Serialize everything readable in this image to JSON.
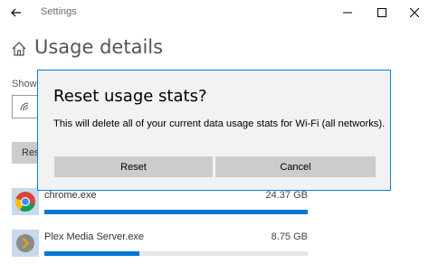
{
  "window": {
    "app_title": "Settings",
    "back_icon": "back-arrow-icon",
    "minimize_icon": "minimize-icon",
    "maximize_icon": "maximize-icon",
    "close_icon": "close-icon"
  },
  "page": {
    "title": "Usage details",
    "home_icon": "home-icon"
  },
  "background": {
    "show_label": "Show",
    "network_icon": "wifi-icon",
    "reset_button_label": "Rese"
  },
  "apps": [
    {
      "name": "chrome.exe",
      "usage": "24.37 GB",
      "icon": "chrome-icon",
      "bar_fraction": 1.0
    },
    {
      "name": "Plex Media Server.exe",
      "usage": "8.75 GB",
      "icon": "plex-icon",
      "bar_fraction": 0.36
    }
  ],
  "dialog": {
    "title": "Reset usage stats?",
    "message": "This will delete all of your current data usage stats for Wi-Fi (all networks).",
    "reset_label": "Reset",
    "cancel_label": "Cancel"
  },
  "colors": {
    "accent": "#0078d7",
    "dialog_border": "#0a7fd8",
    "button_bg": "#cccccc"
  }
}
